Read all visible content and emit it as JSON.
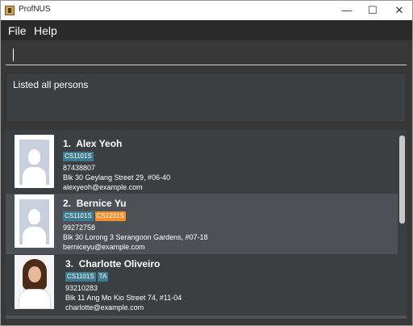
{
  "window": {
    "title": "ProfNUS"
  },
  "menu": {
    "file": "File",
    "help": "Help"
  },
  "command": {
    "value": ""
  },
  "result": {
    "message": "Listed all persons"
  },
  "persons": [
    {
      "index": "1.",
      "name": "Alex Yeoh",
      "tags": [
        "CS1101S"
      ],
      "phone": "87438807",
      "address": "Blk 30 Geylang Street 29, #06-40",
      "email": "alexyeoh@example.com"
    },
    {
      "index": "2.",
      "name": "Bernice Yu",
      "tags": [
        "CS1101S",
        "CS1231S"
      ],
      "phone": "99272758",
      "address": "Blk 30 Lorong 3 Serangoon Gardens, #07-18",
      "email": "berniceyu@example.com"
    },
    {
      "index": "3.",
      "name": "Charlotte Oliveiro",
      "tags": [
        "CS1101S",
        "TA"
      ],
      "phone": "93210283",
      "address": "Blk 11 Ang Mo Kio Street 74, #11-04",
      "email": "charlotte@example.com"
    }
  ],
  "colors": {
    "tag_blue": "#3e7b91",
    "tag_orange": "#f18f2d",
    "background": "#383838",
    "selected_row": "#4d5155"
  },
  "icons": {
    "minimize": "minimize-icon",
    "maximize": "maximize-icon",
    "close": "close-icon"
  }
}
